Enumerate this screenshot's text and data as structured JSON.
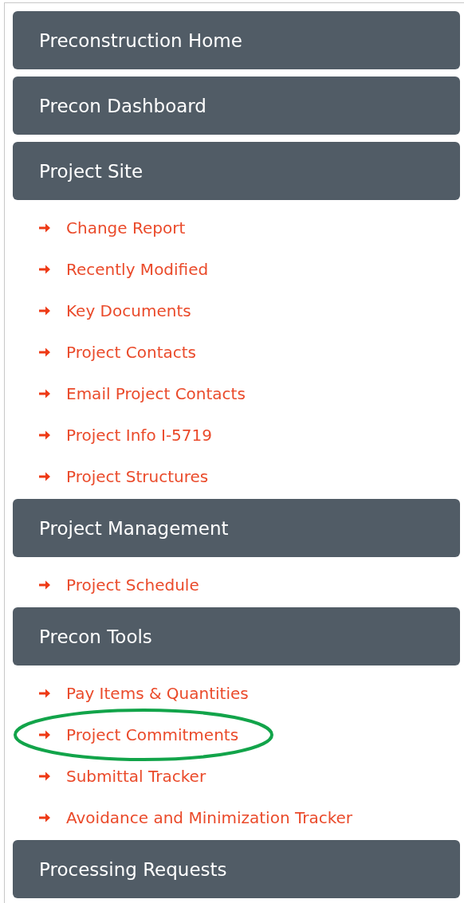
{
  "sections": [
    {
      "title": "Preconstruction Home"
    },
    {
      "title": "Precon Dashboard"
    },
    {
      "title": "Project Site",
      "links": [
        {
          "label": "Change Report",
          "circled": false
        },
        {
          "label": "Recently Modified",
          "circled": false
        },
        {
          "label": "Key Documents",
          "circled": false
        },
        {
          "label": "Project Contacts",
          "circled": false
        },
        {
          "label": "Email Project Contacts",
          "circled": false
        },
        {
          "label": "Project Info I-5719",
          "circled": false
        },
        {
          "label": "Project Structures",
          "circled": false
        }
      ]
    },
    {
      "title": "Project Management",
      "links": [
        {
          "label": "Project Schedule",
          "circled": false
        }
      ]
    },
    {
      "title": "Precon Tools",
      "links": [
        {
          "label": "Pay Items & Quantities",
          "circled": false
        },
        {
          "label": "Project Commitments",
          "circled": true
        },
        {
          "label": "Submittal Tracker",
          "circled": false
        },
        {
          "label": "Avoidance and Minimization Tracker",
          "circled": false
        }
      ]
    },
    {
      "title": "Processing Requests"
    }
  ]
}
